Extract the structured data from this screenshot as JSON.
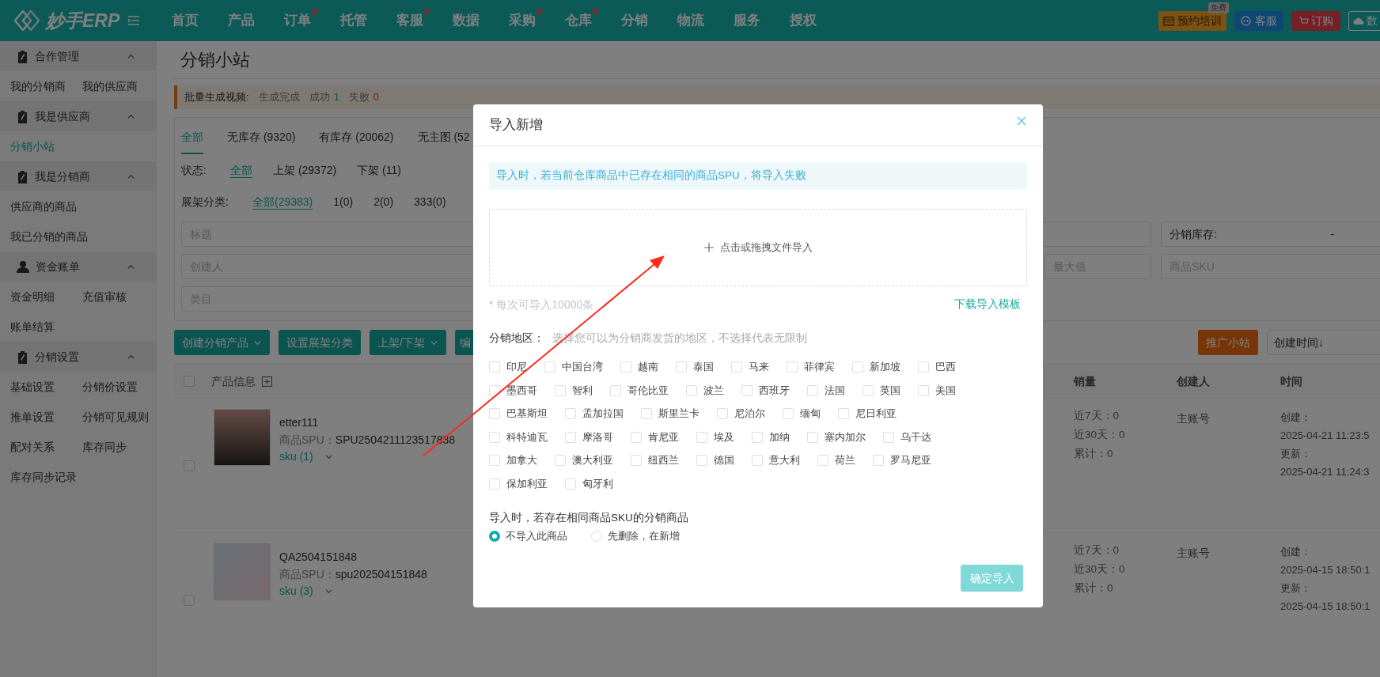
{
  "top_nav": {
    "logo": "妙手ERP",
    "items": [
      {
        "label": "首页",
        "dot": false
      },
      {
        "label": "产品",
        "dot": false
      },
      {
        "label": "订单",
        "dot": true
      },
      {
        "label": "托管",
        "dot": false
      },
      {
        "label": "客服",
        "dot": true
      },
      {
        "label": "数据",
        "dot": false
      },
      {
        "label": "采购",
        "dot": true
      },
      {
        "label": "仓库",
        "dot": true
      },
      {
        "label": "分销",
        "dot": false
      },
      {
        "label": "物流",
        "dot": false
      },
      {
        "label": "服务",
        "dot": false
      },
      {
        "label": "授权",
        "dot": false
      }
    ],
    "buttons": [
      {
        "kind": "training",
        "label": "预约培训",
        "badge": "免费"
      },
      {
        "kind": "service",
        "label": "客服"
      },
      {
        "kind": "order",
        "label": "订购"
      },
      {
        "kind": "cloud",
        "label": "数"
      }
    ]
  },
  "sidebar": {
    "groups": [
      {
        "title": "合作管理",
        "kind": "clipboard",
        "expanded": true,
        "rows": [
          [
            {
              "label": "我的分销商",
              "selected": false
            },
            {
              "label": "我的供应商",
              "selected": false
            }
          ]
        ]
      },
      {
        "title": "我是供应商",
        "kind": "clipboard",
        "expanded": true,
        "rows": [
          [
            {
              "label": "分销小站",
              "selected": true
            }
          ]
        ]
      },
      {
        "title": "我是分销商",
        "kind": "clipboard",
        "expanded": true,
        "rows": [
          [
            {
              "label": "供应商的商品",
              "selected": false
            }
          ],
          [
            {
              "label": "我已分销的商品",
              "selected": false
            }
          ]
        ]
      },
      {
        "title": "资金账单",
        "kind": "user",
        "expanded": true,
        "rows": [
          [
            {
              "label": "资金明细",
              "selected": false
            },
            {
              "label": "充值审核",
              "selected": false
            }
          ],
          [
            {
              "label": "账单结算",
              "selected": false
            }
          ]
        ]
      },
      {
        "title": "分销设置",
        "kind": "clipboard",
        "expanded": true,
        "rows": [
          [
            {
              "label": "基础设置",
              "selected": false
            },
            {
              "label": "分销价设置",
              "selected": false
            }
          ],
          [
            {
              "label": "推单设置",
              "selected": false
            },
            {
              "label": "分销可见规则",
              "selected": false
            }
          ],
          [
            {
              "label": "配对关系",
              "selected": false
            },
            {
              "label": "库存同步",
              "selected": false
            }
          ],
          [
            {
              "label": "库存同步记录",
              "selected": false
            }
          ]
        ]
      }
    ]
  },
  "page": {
    "title": "分销小站",
    "notice": {
      "label": "批量生成视频:",
      "status": "生成完成",
      "success_label": "成功",
      "success_count": "1",
      "fail_label": "失败",
      "fail_count": "0"
    },
    "stock_tabs": [
      {
        "label": "全部",
        "selected": true
      },
      {
        "label": "无库存 (9320)",
        "selected": false
      },
      {
        "label": "有库存 (20062)",
        "selected": false
      },
      {
        "label": "无主图 (52",
        "selected": false
      }
    ],
    "status_filter": {
      "label": "状态:",
      "options": [
        {
          "label": "全部",
          "selected": true
        },
        {
          "label": "上架 (29372)",
          "selected": false
        },
        {
          "label": "下架 (11)",
          "selected": false
        }
      ]
    },
    "shelf_filter": {
      "label": "展架分类:",
      "options": [
        {
          "label": "全部(29383)",
          "selected": true
        },
        {
          "label": "1(0)",
          "selected": false
        },
        {
          "label": "2(0)",
          "selected": false
        },
        {
          "label": "333(0)",
          "selected": false
        }
      ]
    },
    "field_rows": [
      [
        {
          "kind": "text",
          "placeholder": "标题"
        },
        {
          "kind": "range",
          "label": "分销库存:",
          "separator": "-"
        }
      ],
      [
        {
          "kind": "text",
          "placeholder": "创建人"
        },
        {
          "kind": "text",
          "placeholder": "最大值"
        },
        {
          "kind": "text",
          "placeholder": "商品SKU"
        }
      ],
      [
        {
          "kind": "text",
          "placeholder": "类目"
        }
      ]
    ],
    "toolbar": [
      {
        "label": "创建分销产品",
        "dropdown": true
      },
      {
        "label": "设置展架分类",
        "dropdown": false
      },
      {
        "label": "上架/下架",
        "dropdown": true
      },
      {
        "label": "编",
        "dropdown": false
      }
    ],
    "promote_button": "推广小站",
    "sort": "创建时间↓"
  },
  "table": {
    "select_all_checked": false,
    "columns": [
      "产品信息",
      "销量",
      "创建人",
      "时间"
    ],
    "rows": [
      {
        "checked": false,
        "title": "etter111",
        "spu_label": "商品SPU：",
        "spu": "SPU2504211123517838",
        "sku": "sku (1)",
        "sales": [
          "近7天：0",
          "近30天：0",
          "累计：0"
        ],
        "creator": "主账号",
        "time": [
          "创建：",
          "2025-04-21 11:23:5",
          "更新：",
          "2025-04-21 11:24:3"
        ]
      },
      {
        "checked": false,
        "title": "QA2504151848",
        "spu_label": "商品SPU：",
        "spu": "spu202504151848",
        "sku": "sku (3)",
        "sales": [
          "近7天：0",
          "近30天：0",
          "累计：0"
        ],
        "creator": "主账号",
        "time": [
          "创建：",
          "2025-04-15 18:50:1",
          "更新：",
          "2025-04-15 18:50:1"
        ]
      }
    ]
  },
  "modal": {
    "title": "导入新增",
    "alert": "导入时，若当前仓库商品中已存在相同的商品SPU，将导入失败",
    "upload": "点击或拖拽文件导入",
    "note": "* 每次可导入10000条",
    "template_link": "下载导入模板",
    "region_label": "分销地区：",
    "region_hint": "选择您可以为分销商发货的地区，不选择代表无限制",
    "region_rows": [
      [
        {
          "label": "印尼",
          "checked": false
        },
        {
          "label": "中国台湾",
          "checked": false
        },
        {
          "label": "越南",
          "checked": false
        },
        {
          "label": "泰国",
          "checked": false
        },
        {
          "label": "马来",
          "checked": false
        },
        {
          "label": "菲律宾",
          "checked": false
        },
        {
          "label": "新加坡",
          "checked": false
        },
        {
          "label": "巴西",
          "checked": false
        }
      ],
      [
        {
          "label": "墨西哥",
          "checked": false
        },
        {
          "label": "智利",
          "checked": false
        },
        {
          "label": "哥伦比亚",
          "checked": false
        },
        {
          "label": "波兰",
          "checked": false
        },
        {
          "label": "西班牙",
          "checked": false
        },
        {
          "label": "法国",
          "checked": false
        },
        {
          "label": "英国",
          "checked": false
        },
        {
          "label": "美国",
          "checked": false
        }
      ],
      [
        {
          "label": "巴基斯坦",
          "checked": false
        },
        {
          "label": "孟加拉国",
          "checked": false
        },
        {
          "label": "斯里兰卡",
          "checked": false
        },
        {
          "label": "尼泊尔",
          "checked": false
        },
        {
          "label": "缅甸",
          "checked": false
        },
        {
          "label": "尼日利亚",
          "checked": false
        }
      ],
      [
        {
          "label": "科特迪瓦",
          "checked": false
        },
        {
          "label": "摩洛哥",
          "checked": false
        },
        {
          "label": "肯尼亚",
          "checked": false
        },
        {
          "label": "埃及",
          "checked": false
        },
        {
          "label": "加纳",
          "checked": false
        },
        {
          "label": "塞内加尔",
          "checked": false
        },
        {
          "label": "乌干达",
          "checked": false
        }
      ],
      [
        {
          "label": "加拿大",
          "checked": false
        },
        {
          "label": "澳大利亚",
          "checked": false
        },
        {
          "label": "纽西兰",
          "checked": false
        },
        {
          "label": "德国",
          "checked": false
        },
        {
          "label": "意大利",
          "checked": false
        },
        {
          "label": "荷兰",
          "checked": false
        },
        {
          "label": "罗马尼亚",
          "checked": false
        }
      ],
      [
        {
          "label": "保加利亚",
          "checked": false
        },
        {
          "label": "匈牙利",
          "checked": false
        }
      ]
    ],
    "duplicate_label": "导入时，若存在相同商品SKU的分销商品",
    "duplicate_options": [
      {
        "label": "不导入此商品",
        "selected": true
      },
      {
        "label": "先删除，在新增",
        "selected": false
      }
    ],
    "confirm": {
      "label": "确定导入",
      "disabled": true
    }
  }
}
